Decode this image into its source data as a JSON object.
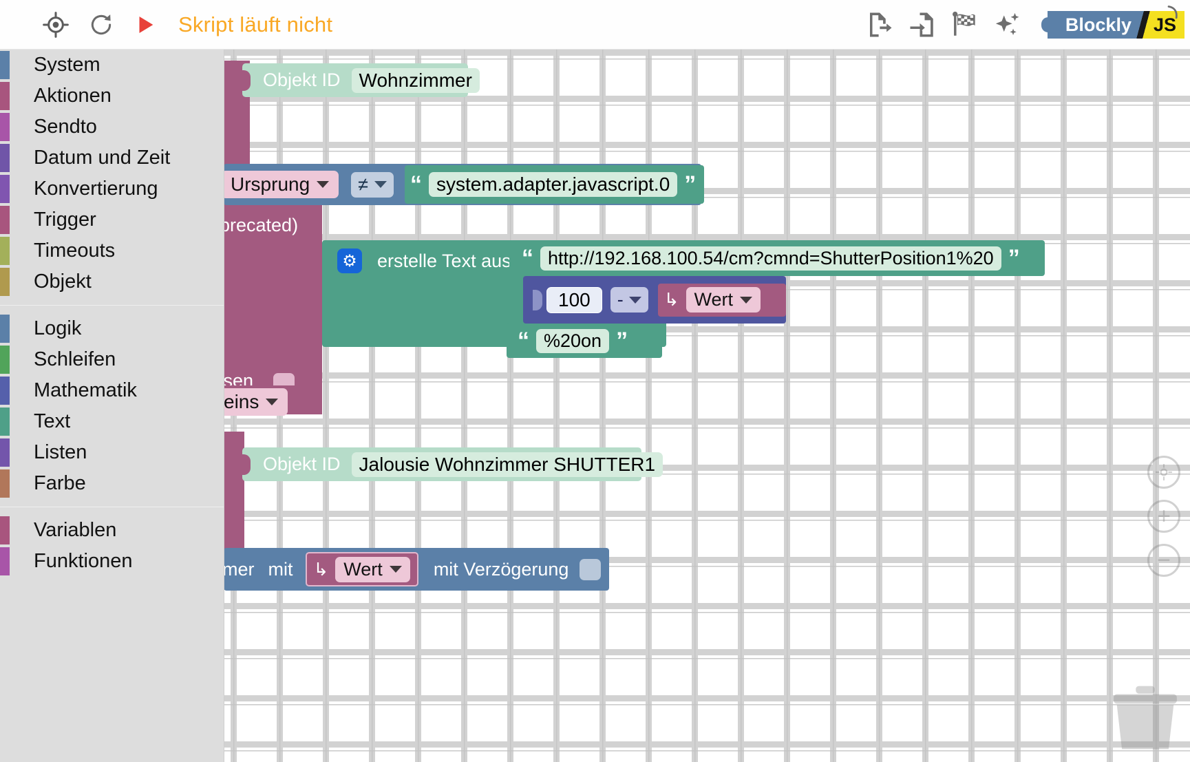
{
  "toolbar": {
    "locate_icon": "target-crosshair-icon",
    "reload_icon": "reload-icon",
    "play_icon": "play-icon",
    "run_status": "Skript läuft nicht",
    "export_icon": "export-blocks-icon",
    "import_icon": "import-blocks-icon",
    "flag_icon": "checkered-flag-icon",
    "sparkles_icon": "sparkles-icon",
    "badge_blockly": "Blockly",
    "badge_js": "JS",
    "status_color": "#f9a825"
  },
  "toolbox": {
    "groups": [
      {
        "categories": [
          {
            "label": "System",
            "color": "#5b80a8"
          },
          {
            "label": "Aktionen",
            "color": "#a8557e"
          },
          {
            "label": "Sendto",
            "color": "#a855a8"
          },
          {
            "label": "Datum und Zeit",
            "color": "#7055a8"
          },
          {
            "label": "Konvertierung",
            "color": "#8055b0"
          },
          {
            "label": "Trigger",
            "color": "#a8557e"
          },
          {
            "label": "Timeouts",
            "color": "#a3b05a"
          },
          {
            "label": "Objekt",
            "color": "#b09a4e"
          }
        ]
      },
      {
        "categories": [
          {
            "label": "Logik",
            "color": "#5b80a8"
          },
          {
            "label": "Schleifen",
            "color": "#51a45a"
          },
          {
            "label": "Mathematik",
            "color": "#5560ab"
          },
          {
            "label": "Text",
            "color": "#4fa088"
          },
          {
            "label": "Listen",
            "color": "#7355ab"
          },
          {
            "label": "Farbe",
            "color": "#b1775a"
          }
        ]
      },
      {
        "categories": [
          {
            "label": "Variablen",
            "color": "#a8557e"
          },
          {
            "label": "Funktionen",
            "color": "#a855a8"
          }
        ]
      }
    ]
  },
  "workspace": {
    "blocks": {
      "objekt_id_label_1": "Objekt ID",
      "objekt_id_value_1": "Wohnzimmer",
      "compare_left_dropdown": "Ursprung",
      "compare_operator": "≠",
      "compare_right_text": "system.adapter.javascript.0",
      "deprecated_fragment": "precated)",
      "text_join_label": "erstelle Text aus",
      "url_text": "http://192.168.100.54/cm?cmnd=ShutterPosition1%20",
      "math_number": "100",
      "math_operator": "-",
      "math_variable": "Wert",
      "on_text": "%20on",
      "close_fragment": "ssen",
      "eins_dropdown": "eins",
      "objekt_id_label_2": "Objekt ID",
      "objekt_id_value_2": "Jalousie Wohnzimmer SHUTTER1",
      "delay_prefix": "mer",
      "delay_mit": "mit",
      "delay_variable": "Wert",
      "delay_suffix": "mit Verzögerung"
    },
    "colors": {
      "objekt_id_block": "#b6dcc9",
      "mauve_block": "#a35a80",
      "compare_block": "#5b80a8",
      "text_block": "#4fa088",
      "math_block": "#4f569f",
      "variable_block": "#a35a80"
    }
  },
  "zoom_controls": {
    "center_icon": "zoom-center-icon",
    "zoom_in": "+",
    "zoom_out": "−",
    "trash_icon": "trash-can-icon"
  }
}
